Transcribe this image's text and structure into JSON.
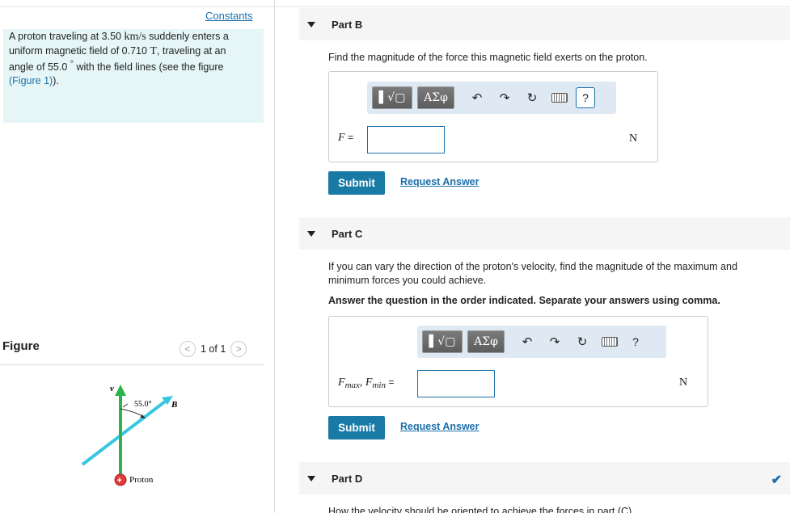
{
  "left_panel": {
    "constants_link": "Constants",
    "problem": {
      "t1": "A proton traveling at 3.50 ",
      "u1": "km/s",
      "t2": " suddenly enters a uniform magnetic field of 0.710 ",
      "u2": "T",
      "t3": ", traveling at an angle of 55.0 ",
      "deg": "°",
      "t4": " with the field lines (see the figure ",
      "figure_link": "(Figure 1)",
      "t5": ")."
    },
    "figure_label": "Figure",
    "pager": {
      "prev": "<",
      "text": "1 of 1",
      "next": ">"
    },
    "figure": {
      "v_label": "v⃗",
      "b_label": "B⃗",
      "angle_label": "55.0°",
      "proton_label": "Proton",
      "proton_sign": "+"
    }
  },
  "colors": {
    "accent": "#1a7aa6",
    "field_line": "#39c6e0",
    "velocity": "#2db34a",
    "proton": "#e03a3a"
  },
  "parts": {
    "b": {
      "title": "Part B",
      "question": "Find the magnitude of the force this magnetic field exerts on the proton.",
      "toolbar": {
        "templates": "▌√▢",
        "greek": "ΑΣφ",
        "undo": "↶",
        "redo": "↷",
        "reset": "↻",
        "keyboard": "keyboard-icon",
        "help": "?"
      },
      "var_label": "F",
      "eq": "=",
      "value": "",
      "unit": "N",
      "submit": "Submit",
      "request": "Request Answer"
    },
    "c": {
      "title": "Part C",
      "question": "If you can vary the direction of the proton's velocity, find the magnitude of the maximum and minimum forces you could achieve.",
      "instruction": "Answer the question in the order indicated. Separate your answers using comma.",
      "toolbar": {
        "templates": "▌√▢",
        "greek": "ΑΣφ",
        "undo": "↶",
        "redo": "↷",
        "reset": "↻",
        "keyboard": "keyboard-icon",
        "help": "?"
      },
      "var1": "F",
      "sub1": "max",
      "sep": ", ",
      "var2": "F",
      "sub2": "min",
      "eq": "=",
      "value": "",
      "unit": "N",
      "submit": "Submit",
      "request": "Request Answer"
    },
    "d": {
      "title": "Part D",
      "completed": "✔",
      "question": "How the velocity should be oriented to achieve the forces in part (C)"
    }
  }
}
